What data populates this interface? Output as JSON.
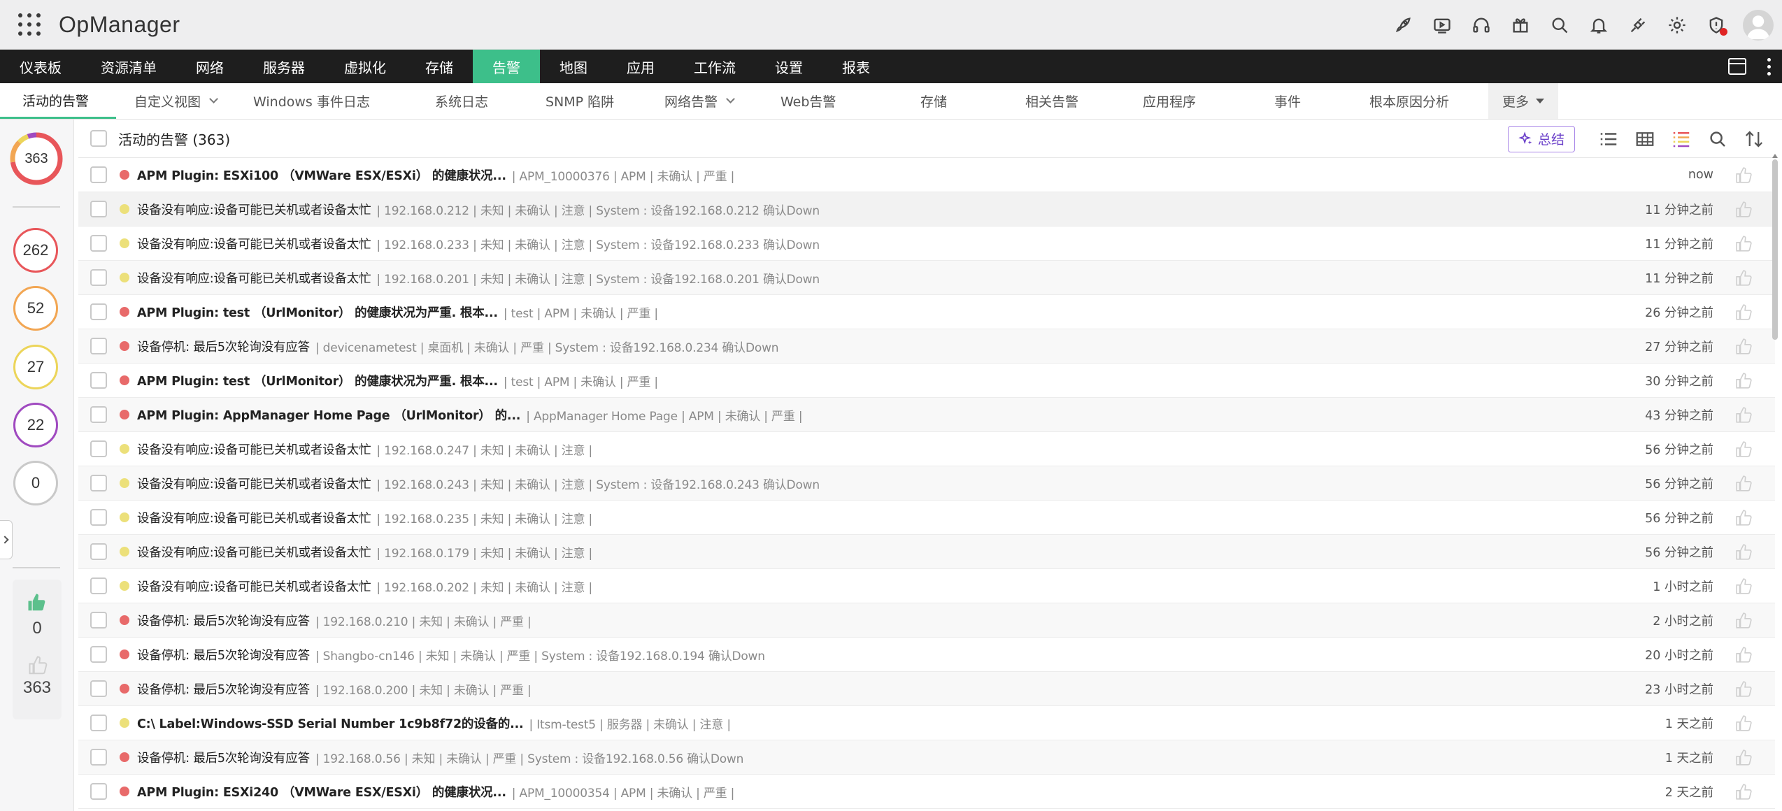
{
  "app": {
    "title": "OpManager"
  },
  "header_icons": [
    "rocket-icon",
    "video-icon",
    "headset-icon",
    "gift-icon",
    "search-icon",
    "bell-icon",
    "plug-icon",
    "gear-icon",
    "shield-alert-icon"
  ],
  "mainnav": {
    "items": [
      "仪表板",
      "资源清单",
      "网络",
      "服务器",
      "虚拟化",
      "存储",
      "告警",
      "地图",
      "应用",
      "工作流",
      "设置",
      "报表"
    ],
    "active": "告警"
  },
  "subnav": {
    "items": [
      "活动的告警",
      "自定义视图",
      "Windows 事件日志",
      "系统日志",
      "SNMP 陷阱",
      "网络告警",
      "Web告警",
      "存储",
      "相关告警",
      "应用程序",
      "事件",
      "根本原因分析"
    ],
    "more": "更多"
  },
  "leftrail": {
    "total": "363",
    "counts": [
      {
        "value": "262",
        "color": "#e8565a"
      },
      {
        "value": "52",
        "color": "#f2a653"
      },
      {
        "value": "27",
        "color": "#ecd55a"
      },
      {
        "value": "22",
        "color": "#a04ac0"
      },
      {
        "value": "0",
        "color": "#c9c9c9"
      }
    ],
    "acknowledged": "0",
    "unacknowledged": "363"
  },
  "table": {
    "title": "活动的告警 (363)",
    "summary_label": "总结",
    "rows": [
      {
        "severity": "#e86a6a",
        "bold": true,
        "message": "APM Plugin: ESXi100 （VMWare ESX/ESXi） 的健康状况...",
        "meta": "| APM_10000376 | APM | 未确认 | 严重 |",
        "time": "now"
      },
      {
        "severity": "#ece07a",
        "bold": false,
        "message": "设备没有响应:设备可能已关机或者设备太忙",
        "meta": "| 192.168.0.212 | 未知 | 未确认 | 注意 | System : 设备192.168.0.212 确认Down",
        "time": "11 分钟之前"
      },
      {
        "severity": "#ece07a",
        "bold": false,
        "message": "设备没有响应:设备可能已关机或者设备太忙",
        "meta": "| 192.168.0.233 | 未知 | 未确认 | 注意 | System : 设备192.168.0.233 确认Down",
        "time": "11 分钟之前"
      },
      {
        "severity": "#ece07a",
        "bold": false,
        "message": "设备没有响应:设备可能已关机或者设备太忙",
        "meta": "| 192.168.0.201 | 未知 | 未确认 | 注意 | System : 设备192.168.0.201 确认Down",
        "time": "11 分钟之前"
      },
      {
        "severity": "#e86a6a",
        "bold": true,
        "message": "APM Plugin: test （UrlMonitor） 的健康状况为严重. 根本...",
        "meta": "| test | APM | 未确认 | 严重 |",
        "time": "26 分钟之前"
      },
      {
        "severity": "#e86a6a",
        "bold": false,
        "message": "设备停机: 最后5次轮询没有应答",
        "meta": "| devicenametest | 桌面机 | 未确认 | 严重 | System : 设备192.168.0.234 确认Down",
        "time": "27 分钟之前"
      },
      {
        "severity": "#e86a6a",
        "bold": true,
        "message": "APM Plugin: test （UrlMonitor） 的健康状况为严重. 根本...",
        "meta": "| test | APM | 未确认 | 严重 |",
        "time": "30 分钟之前"
      },
      {
        "severity": "#e86a6a",
        "bold": true,
        "message": "APM Plugin: AppManager Home Page （UrlMonitor） 的...",
        "meta": "| AppManager Home Page | APM | 未确认 | 严重 |",
        "time": "43 分钟之前"
      },
      {
        "severity": "#ece07a",
        "bold": false,
        "message": "设备没有响应:设备可能已关机或者设备太忙",
        "meta": "| 192.168.0.247 | 未知 | 未确认 | 注意 |",
        "time": "56 分钟之前"
      },
      {
        "severity": "#ece07a",
        "bold": false,
        "message": "设备没有响应:设备可能已关机或者设备太忙",
        "meta": "| 192.168.0.243 | 未知 | 未确认 | 注意 | System : 设备192.168.0.243 确认Down",
        "time": "56 分钟之前"
      },
      {
        "severity": "#ece07a",
        "bold": false,
        "message": "设备没有响应:设备可能已关机或者设备太忙",
        "meta": "| 192.168.0.235 | 未知 | 未确认 | 注意 |",
        "time": "56 分钟之前"
      },
      {
        "severity": "#ece07a",
        "bold": false,
        "message": "设备没有响应:设备可能已关机或者设备太忙",
        "meta": "| 192.168.0.179 | 未知 | 未确认 | 注意 |",
        "time": "56 分钟之前"
      },
      {
        "severity": "#ece07a",
        "bold": false,
        "message": "设备没有响应:设备可能已关机或者设备太忙",
        "meta": "| 192.168.0.202 | 未知 | 未确认 | 注意 |",
        "time": "1 小时之前"
      },
      {
        "severity": "#e86a6a",
        "bold": false,
        "message": "设备停机: 最后5次轮询没有应答",
        "meta": "| 192.168.0.210 | 未知 | 未确认 | 严重 |",
        "time": "2 小时之前"
      },
      {
        "severity": "#e86a6a",
        "bold": false,
        "message": "设备停机: 最后5次轮询没有应答",
        "meta": "| Shangbo-cn146 | 未知 | 未确认 | 严重 | System : 设备192.168.0.194 确认Down",
        "time": "20 小时之前"
      },
      {
        "severity": "#e86a6a",
        "bold": false,
        "message": "设备停机: 最后5次轮询没有应答",
        "meta": "| 192.168.0.200 | 未知 | 未确认 | 严重 |",
        "time": "23 小时之前"
      },
      {
        "severity": "#ece07a",
        "bold": true,
        "message": "C:\\ Label:Windows-SSD Serial Number 1c9b8f72的设备的...",
        "meta": "| Itsm-test5 | 服务器 | 未确认 | 注意 |",
        "time": "1 天之前"
      },
      {
        "severity": "#e86a6a",
        "bold": false,
        "message": "设备停机: 最后5次轮询没有应答",
        "meta": "| 192.168.0.56 | 未知 | 未确认 | 严重 | System : 设备192.168.0.56 确认Down",
        "time": "1 天之前"
      },
      {
        "severity": "#e86a6a",
        "bold": true,
        "message": "APM Plugin: ESXi240 （VMWare ESX/ESXi） 的健康状况...",
        "meta": "| APM_10000354 | APM | 未确认 | 严重 |",
        "time": "2 天之前"
      }
    ]
  }
}
